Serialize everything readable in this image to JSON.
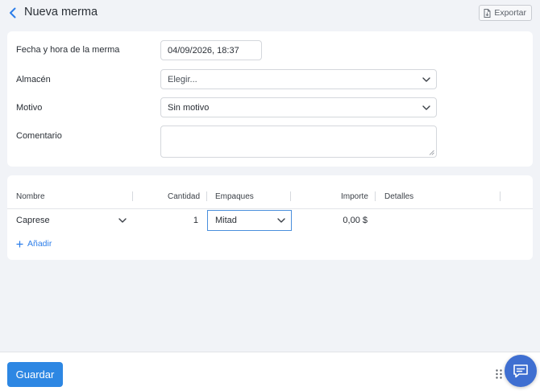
{
  "header": {
    "title": "Nueva merma",
    "export_label": "Exportar"
  },
  "form": {
    "datetime_label": "Fecha y hora de la merma",
    "datetime_value": "04/09/2026, 18:37",
    "warehouse_label": "Almacén",
    "warehouse_value": "Elegir...",
    "reason_label": "Motivo",
    "reason_value": "Sin motivo",
    "comment_label": "Comentario",
    "comment_value": ""
  },
  "table": {
    "columns": {
      "name": "Nombre",
      "quantity": "Cantidad",
      "packaging": "Empaques",
      "amount": "Importe",
      "details": "Detalles"
    },
    "rows": [
      {
        "name": "Caprese",
        "quantity": "1",
        "packaging": "Mitad",
        "amount": "0,00 $",
        "details": ""
      }
    ],
    "add_label": "Añadir"
  },
  "footer": {
    "save_label": "Guardar"
  },
  "icons": {
    "back": "chevron-left-icon",
    "export": "document-icon",
    "dropdown": "chevron-down-icon",
    "add": "plus-icon",
    "drag": "drag-handle-icon",
    "chat": "chat-icon"
  },
  "colors": {
    "accent": "#2d87e3",
    "link": "#2b7de9",
    "focus_border": "#4a8fdc",
    "chat": "#3f6fd1",
    "background": "#f1f3f7"
  }
}
